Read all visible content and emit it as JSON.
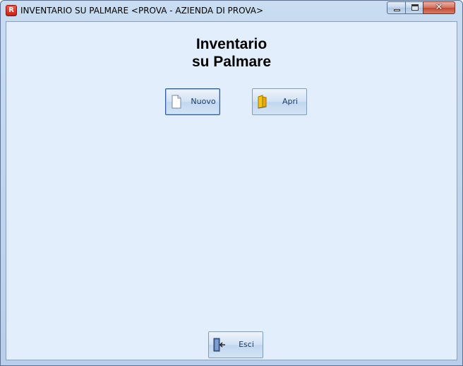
{
  "window": {
    "app_icon_letter": "R",
    "title": "INVENTARIO SU PALMARE <PROVA - AZIENDA DI PROVA>",
    "controls": {
      "minimize_icon": "minimize-icon",
      "maximize_icon": "maximize-icon",
      "close_icon": "close-icon",
      "close_glyph": "✕"
    }
  },
  "main": {
    "heading_line1": "Inventario",
    "heading_line2": "su Palmare"
  },
  "buttons": {
    "nuovo": {
      "label": "Nuovo",
      "icon": "new-document-icon"
    },
    "apri": {
      "label": "Apri",
      "icon": "open-folder-icon"
    },
    "esci": {
      "label": "Esci",
      "icon": "exit-door-icon"
    }
  },
  "colors": {
    "client_background": "#e2eefb",
    "button_text": "#1a3a63",
    "close_button": "#c14a34"
  }
}
